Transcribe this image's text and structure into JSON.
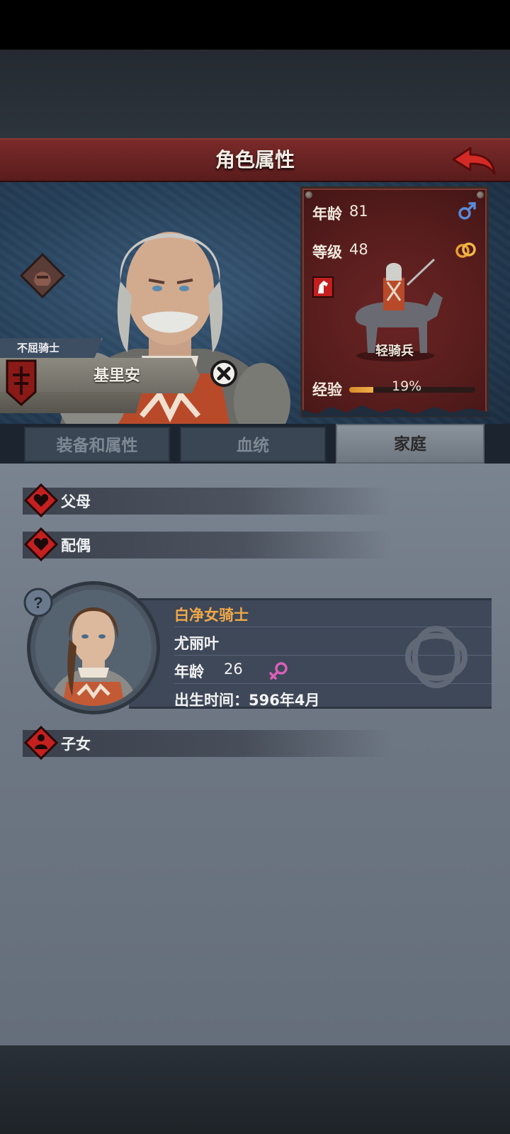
{
  "header": {
    "title": "角色属性"
  },
  "character": {
    "title": "不屈骑士",
    "name": "基里安"
  },
  "stats": {
    "age_label": "年龄",
    "age": "81",
    "level_label": "等级",
    "level": "48",
    "unit": "轻骑兵",
    "exp_label": "经验",
    "exp_percent_text": "19%",
    "exp_fraction": 0.19
  },
  "tabs": [
    {
      "label": "装备和属性",
      "active": false
    },
    {
      "label": "血统",
      "active": false
    },
    {
      "label": "家庭",
      "active": true
    }
  ],
  "family": {
    "parents_label": "父母",
    "spouse_label": "配偶",
    "children_label": "子女",
    "spouse": {
      "title": "白净女骑士",
      "name": "尤丽叶",
      "age_label": "年龄",
      "age": "26",
      "birth_text": "出生时间：596年4月"
    }
  },
  "icons": {
    "back": "back-arrow-icon",
    "close": "close-icon",
    "male": "male-symbol-icon",
    "female": "female-symbol-icon",
    "marriage": "wedding-rings-icon",
    "horse": "horse-badge-icon",
    "heart": "heart-diamond-icon",
    "child": "child-diamond-icon",
    "question": "question-mark-icon",
    "helmet": "helmet-diamond-icon",
    "crest": "red-crest-icon"
  },
  "colors": {
    "header_red": "#6e2222",
    "accent_orange": "#f0a848",
    "male_blue": "#5a8ad8",
    "female_pink": "#d860b8",
    "exp_fill": "#e09a36"
  }
}
